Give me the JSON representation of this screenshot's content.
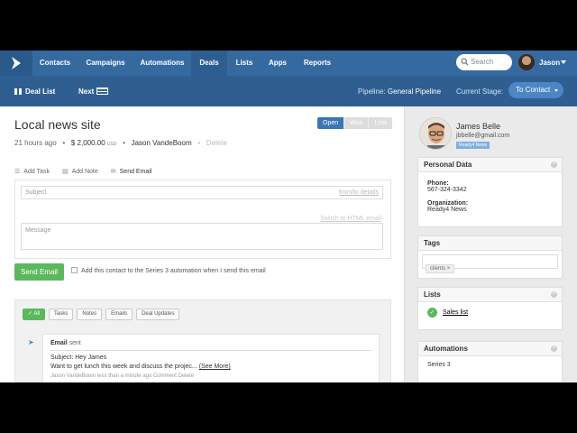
{
  "nav": {
    "items": [
      {
        "label": "Contacts"
      },
      {
        "label": "Campaigns"
      },
      {
        "label": "Automations"
      },
      {
        "label": "Deals"
      },
      {
        "label": "Lists"
      },
      {
        "label": "Apps"
      },
      {
        "label": "Reports"
      }
    ],
    "active": "Deals",
    "search_placeholder": "Search",
    "user": "Jason"
  },
  "subbar": {
    "deal_list": "Deal List",
    "next": "Next",
    "pipeline_label": "Pipeline:",
    "pipeline_value": "General Pipeline",
    "stage_label": "Current Stage:",
    "stage_value": "To Contact"
  },
  "deal": {
    "title": "Local news site",
    "time": "21 hours ago",
    "amount": "$ 2,000.00",
    "currency": "USD",
    "owner": "Jason VandeBoom",
    "delete": "Delete",
    "status": {
      "open": "Open",
      "won": "Won",
      "lost": "Lost"
    }
  },
  "actions": {
    "task": "Add Task",
    "note": "Add Note",
    "email": "Send Email"
  },
  "compose": {
    "subject_placeholder": "Subject",
    "from_link": "from/to details",
    "html_link": "Switch to HTML email",
    "message_placeholder": "Message",
    "send": "Send Email",
    "automation_text": "Add this contact to the Series 3 automation when I send this email"
  },
  "feed": {
    "filters": [
      "All",
      "Tasks",
      "Notes",
      "Emails",
      "Deal Updates"
    ],
    "item": {
      "title": "Email",
      "title_suffix": "sent",
      "subject": "Subject: Hey James",
      "body": "Want to get lunch this week and discuss the projec...",
      "see_more": "(See More)",
      "footer": "Jason VandeBoom  less than a minute ago  Comment  Delete"
    }
  },
  "contact": {
    "name": "James Belle",
    "email": "jbbelle@gmail.com",
    "tag": "Ready4 News"
  },
  "panels": {
    "personal": {
      "title": "Personal Data",
      "phone_label": "Phone:",
      "phone": "567-324-3342",
      "org_label": "Organization:",
      "org": "Ready4 News"
    },
    "tags": {
      "title": "Tags",
      "chip": "clients"
    },
    "lists": {
      "title": "Lists",
      "item": "Sales list"
    },
    "automations": {
      "title": "Automations",
      "item": "Series 3"
    }
  },
  "colors": {
    "nav": "#356aa0",
    "subbar": "#2f5f91",
    "accent": "#4b86c5",
    "success": "#5cb85c"
  }
}
